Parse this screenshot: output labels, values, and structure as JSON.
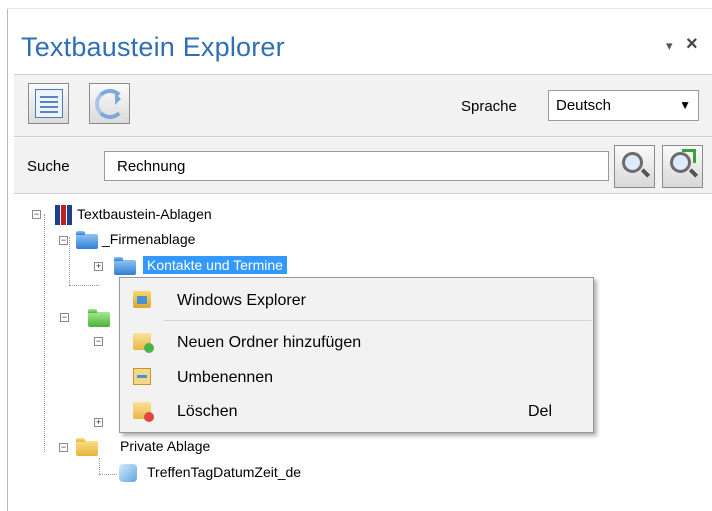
{
  "panel": {
    "title": "Textbaustein Explorer",
    "pin_glyph": "▾",
    "close_glyph": "×"
  },
  "toolbar": {
    "list_icon": "list-view-icon",
    "refresh_icon": "refresh-icon",
    "language_label": "Sprache",
    "language_value": "Deutsch",
    "dropdown_arrow": "▼"
  },
  "search": {
    "label": "Suche",
    "value": "Rechnung",
    "search_icon": "magnifier-icon",
    "search_next_icon": "magnifier-arrow-icon"
  },
  "tree": {
    "root": "Textbaustein-Ablagen",
    "firm": "_Firmenablage",
    "contacts": "Kontakte und Termine",
    "private": "Private Ablage",
    "private_child": "TreffenTagDatumZeit_de",
    "collapse_glyph": "−",
    "expand_glyph": "+"
  },
  "context_menu": {
    "items": [
      {
        "label": "Windows Explorer",
        "shortcut": "",
        "icon": "windows-explorer-icon"
      },
      {
        "label": "Neuen Ordner hinzufügen",
        "shortcut": "",
        "icon": "folder-add-icon"
      },
      {
        "label": "Umbenennen",
        "shortcut": "",
        "icon": "rename-icon"
      },
      {
        "label": "Löschen",
        "shortcut": "Del",
        "icon": "folder-delete-icon"
      }
    ]
  },
  "colors": {
    "title": "#2f6fb4",
    "selection": "#3399ff",
    "toolbar_bg": "#f2f2f2"
  }
}
